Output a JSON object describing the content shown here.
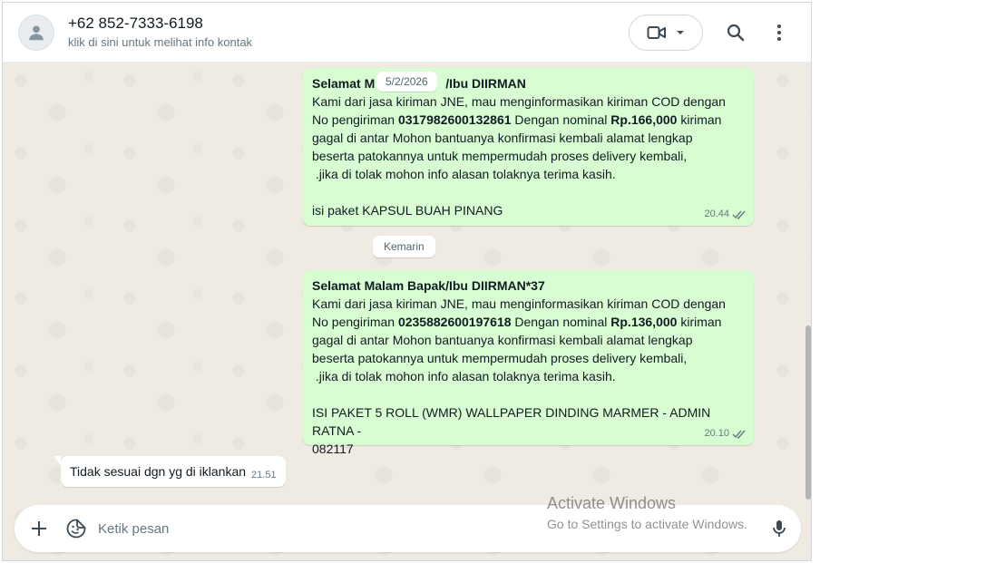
{
  "header": {
    "contact_name": "+62 852-7333-6198",
    "contact_subtitle": "klik di sini untuk melihat info kontak",
    "icons": [
      "person-icon",
      "video-camera-icon",
      "caret-down-icon",
      "search-icon",
      "more-vertical-icon"
    ]
  },
  "messages": {
    "date_pill_1": "5/2/2026",
    "msg1": {
      "greeting_a": "Selamat M",
      "greeting_b": "/Ibu DIIRMAN",
      "line1": "Kami dari jasa kiriman JNE, mau menginformasikan kiriman COD dengan",
      "line2_pre": "No pengiriman ",
      "tracking": "031798260013286",
      "tracking_end": "1",
      "line2_mid": " Dengan nominal ",
      "amount": "Rp.166,000",
      "line2_post": " kiriman",
      "line3": "gagal di antar Mohon bantuanya konfirmasi kembali alamat lengkap",
      "line4": "beserta patokannya untuk mempermudah proses delivery kembali,",
      "line5": " .jika di tolak mohon info alasan tolaknya terima kasih.",
      "line6": "isi paket KAPSUL BUAH PINANG",
      "time": "20.44"
    },
    "date_pill_2": "Kemarin",
    "msg2": {
      "greeting": "Selamat Malam Bapak/Ibu DIIRMAN*37",
      "line1": "Kami dari jasa kiriman JNE, mau menginformasikan kiriman COD dengan",
      "line2_pre": "No pengiriman ",
      "tracking": "0235882600197618",
      "line2_mid": " Dengan nominal ",
      "amount": "Rp.136,000",
      "line2_post": " kiriman",
      "line3": "gagal di antar Mohon bantuanya konfirmasi kembali alamat lengkap",
      "line4": "beserta patokannya untuk mempermudah proses delivery kembali,",
      "line5": " .jika di tolak mohon info alasan tolaknya terima kasih.",
      "line6": "ISI PAKET 5 ROLL (WMR) WALLPAPER DINDING MARMER - ADMIN RATNA -",
      "line7": "082117",
      "time": "20.10"
    },
    "msg3": {
      "text": "Tidak sesuai dgn yg di iklankan",
      "time": "21.51"
    }
  },
  "composer": {
    "placeholder": "Ketik pesan",
    "icons": [
      "plus-icon",
      "sticker-icon",
      "microphone-icon"
    ]
  },
  "watermark": {
    "title": "Activate Windows",
    "subtitle": "Go to Settings to activate Windows."
  },
  "colors": {
    "outgoing_bubble": "#d9fdd3",
    "incoming_bubble": "#ffffff",
    "chat_background": "#efeae2",
    "read_tick": "#667781"
  }
}
